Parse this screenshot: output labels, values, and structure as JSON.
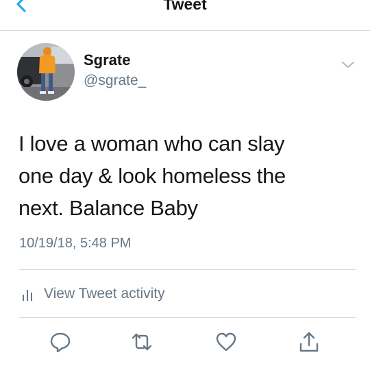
{
  "navbar": {
    "title": "Tweet",
    "back_icon": "chevron-left-icon"
  },
  "tweet": {
    "author_name": "Sgrate",
    "author_handle": "@sgrate_",
    "text_lines": [
      "I love a woman who can slay",
      "one day & look homeless the",
      "next. Balance Baby"
    ],
    "timestamp": "10/19/18, 5:48 PM",
    "activity_label": "View Tweet activity"
  },
  "actions": [
    "reply-icon",
    "retweet-icon",
    "like-icon",
    "share-icon"
  ],
  "colors": {
    "accent": "#1da1f2",
    "text": "#14171a",
    "secondary": "#657786",
    "divider": "#d6dbe0"
  }
}
